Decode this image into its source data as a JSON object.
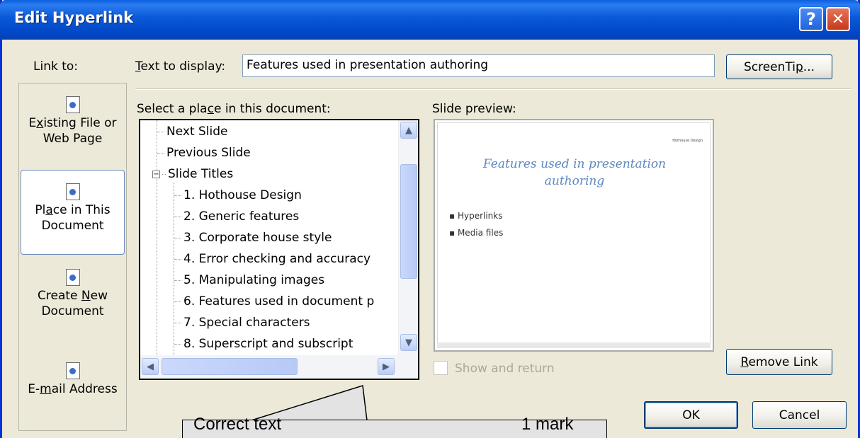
{
  "window": {
    "title": "Edit Hyperlink",
    "help_glyph": "?",
    "close_glyph": "✕"
  },
  "link_to": {
    "label": "Link to:",
    "items": [
      {
        "line1": "Existing File or",
        "line2": "Web Page",
        "icon": "existing-file-icon",
        "active": false
      },
      {
        "line1": "Place in This",
        "line2": "Document",
        "icon": "place-in-document-icon",
        "active": true
      },
      {
        "line1": "Create New",
        "line2": "Document",
        "icon": "create-new-document-icon",
        "active": false
      },
      {
        "line1": "E-mail Address",
        "line2": "",
        "icon": "email-address-icon",
        "active": false
      }
    ]
  },
  "text_to_display": {
    "label": "Text to display:",
    "value": "Features used in presentation authoring"
  },
  "screentip_button": "ScreenTip...",
  "place_in_document": {
    "label": "Select a place in this document:",
    "tree": [
      {
        "text": "Next Slide",
        "level": 0
      },
      {
        "text": "Previous Slide",
        "level": 0
      },
      {
        "text": "Slide Titles",
        "level": 0,
        "expander": "−"
      },
      {
        "text": "1. Hothouse Design",
        "level": 1
      },
      {
        "text": "2. Generic features",
        "level": 1
      },
      {
        "text": "3. Corporate house style",
        "level": 1
      },
      {
        "text": "4. Error checking and accuracy",
        "level": 1
      },
      {
        "text": "5. Manipulating images",
        "level": 1
      },
      {
        "text": "6. Features used in document p",
        "level": 1
      },
      {
        "text": "7. Special characters",
        "level": 1
      },
      {
        "text": "8. Superscript and subscript",
        "level": 1
      }
    ]
  },
  "slide_preview": {
    "label": "Slide preview:",
    "header_text": "Hothouse Design",
    "title": "Features used in presentation authoring",
    "bullets": [
      "Hyperlinks",
      "Media files"
    ]
  },
  "show_and_return": {
    "label": "Show and return",
    "checked": false,
    "enabled": false
  },
  "buttons": {
    "remove_link": "Remove Link",
    "ok": "OK",
    "cancel": "Cancel"
  },
  "callout": {
    "text_left": "Correct text",
    "text_right": "1 mark"
  },
  "colors": {
    "titlebar": "#0a58d8",
    "dialog_bg": "#ece9d8",
    "preview_title": "#5b87c2"
  }
}
